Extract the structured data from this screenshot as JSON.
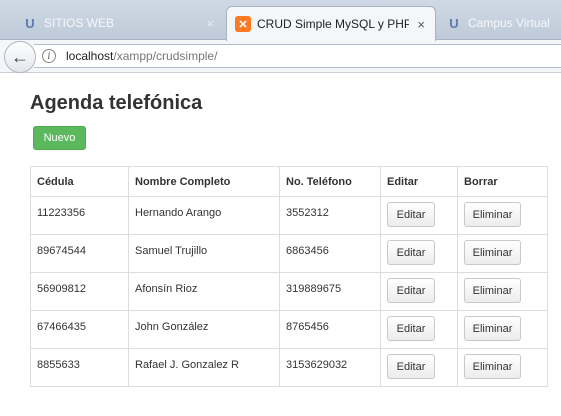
{
  "browser": {
    "tabs": [
      {
        "title": "SITIOS WEB",
        "favicon": "u-icon",
        "active": false
      },
      {
        "title": "CRUD Simple MySQL y PHP",
        "favicon": "xampp-icon",
        "active": true
      },
      {
        "title": "Campus Virtual UNA",
        "favicon": "u-icon",
        "active": false
      }
    ],
    "tab_close_glyph": "×",
    "back_glyph": "←",
    "info_glyph": "i",
    "url_host": "localhost",
    "url_path": "/xampp/crudsimple/"
  },
  "page": {
    "title": "Agenda telefónica",
    "new_button": "Nuevo",
    "accent_color": "#5cb85c",
    "table": {
      "headers": [
        "Cédula",
        "Nombre Completo",
        "No. Teléfono",
        "Editar",
        "Borrar"
      ],
      "rows": [
        {
          "cedula": "11223356",
          "nombre": "Hernando Arango",
          "telefono": "3552312"
        },
        {
          "cedula": "89674544",
          "nombre": "Samuel Trujillo",
          "telefono": "6863456"
        },
        {
          "cedula": "56909812",
          "nombre": "Afonsín Rioz",
          "telefono": "319889675"
        },
        {
          "cedula": "67466435",
          "nombre": "John González",
          "telefono": "8765456"
        },
        {
          "cedula": "8855633",
          "nombre": "Rafael J. Gonzalez R",
          "telefono": "3153629032"
        }
      ],
      "edit_label": "Editar",
      "delete_label": "Eliminar"
    }
  }
}
